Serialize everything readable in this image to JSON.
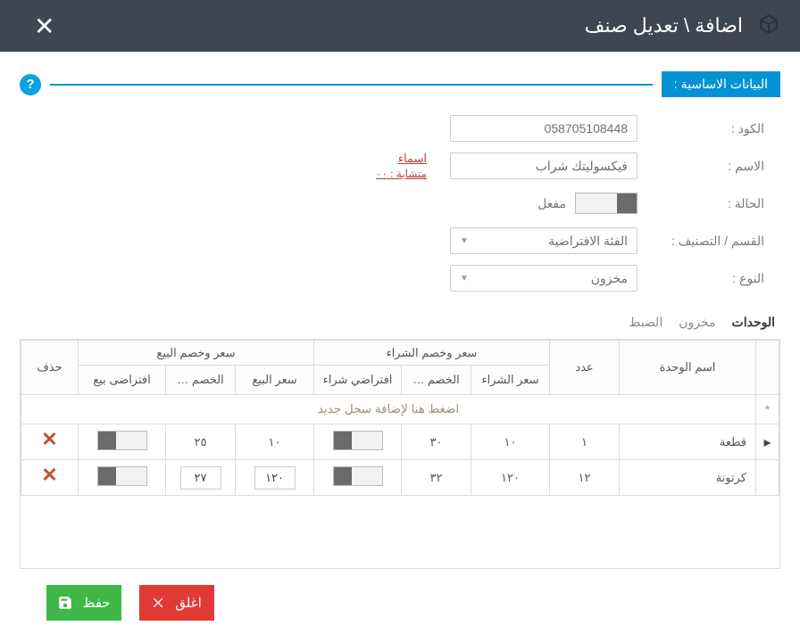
{
  "titlebar": {
    "title": "اضافة \\ تعديل صنف"
  },
  "section": {
    "heading": "البيانات الاساسية :"
  },
  "form": {
    "code_label": "الكود :",
    "code_value": "058705108448",
    "name_label": "الاسم :",
    "name_value": "فيكسوليتك شراب",
    "similar_names_label": "اسماء",
    "similar_names_sub": "متشابة : ٠٠",
    "status_label": "الحالة :",
    "status_text": "مفعل",
    "category_label": "القسم / التصنيف :",
    "category_value": "الفئة الافتراضية",
    "type_label": "النوع :",
    "type_value": "مخزون"
  },
  "tabs": {
    "units": "الوحدات",
    "stock": "مخزون",
    "settings": "الضبط"
  },
  "grid": {
    "unit_name": "اسم الوحدة",
    "count": "عدد",
    "buy_group": "سعر وخصم الشراء",
    "buy_price": "سعر الشراء",
    "buy_disc": "الخصم …",
    "buy_default": "افتراضي شراء",
    "sell_group": "سعر وخصم البيع",
    "sell_price": "سعر البيع",
    "sell_disc": "الخصم …",
    "sell_default": "افتراضى بيع",
    "delete": "حذف",
    "add_hint": "اضغط هنا لإضافة سجل جديد",
    "rows": [
      {
        "unit": "قطعة",
        "count": "١",
        "buy_price": "١٠",
        "buy_disc": "٣٠",
        "sell_price": "١٠",
        "sell_disc": "٢٥"
      },
      {
        "unit": "كرتونة",
        "count": "١٢",
        "buy_price": "١٢٠",
        "buy_disc": "٣٢",
        "sell_price": "١٢٠",
        "sell_disc": "٢٧"
      }
    ]
  },
  "footer": {
    "close": "اغلق",
    "save": "حفظ"
  }
}
